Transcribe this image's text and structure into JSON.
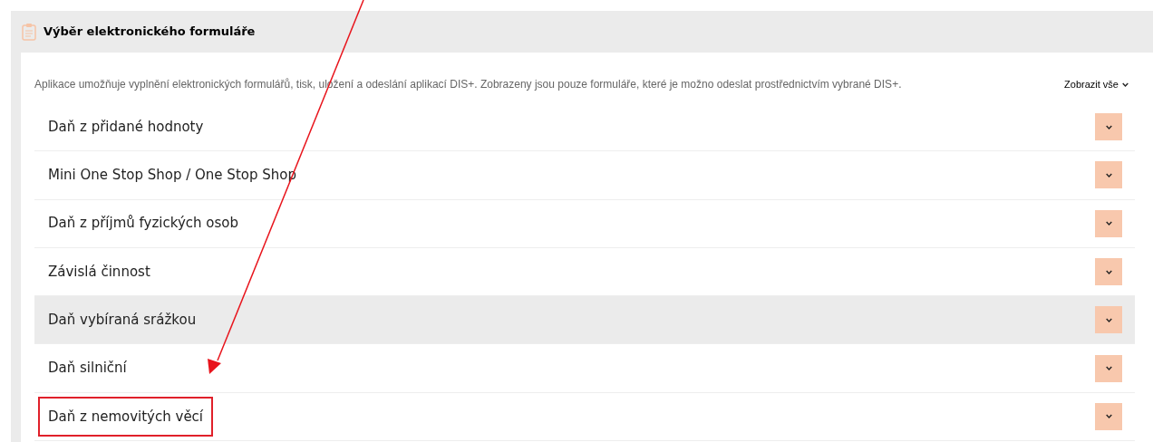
{
  "panel": {
    "title": "Výběr elektronického formuláře"
  },
  "description": "Aplikace umožňuje vyplnění elektronických formulářů, tisk, uložení a odeslání aplikací DIS+. Zobrazeny jsou pouze formuláře, které je možno odeslat prostřednictvím vybrané DIS+.",
  "show_all": "Zobrazit vše",
  "rows": [
    {
      "label": "Daň z přidané hodnoty",
      "hovered": false,
      "marked": false
    },
    {
      "label": "Mini One Stop Shop / One Stop Shop",
      "hovered": false,
      "marked": false
    },
    {
      "label": "Daň z příjmů fyzických osob",
      "hovered": false,
      "marked": false
    },
    {
      "label": "Závislá činnost",
      "hovered": false,
      "marked": false
    },
    {
      "label": "Daň vybíraná srážkou",
      "hovered": true,
      "marked": false
    },
    {
      "label": "Daň silniční",
      "hovered": false,
      "marked": false
    },
    {
      "label": "Daň z nemovitých věcí",
      "hovered": false,
      "marked": true
    }
  ]
}
